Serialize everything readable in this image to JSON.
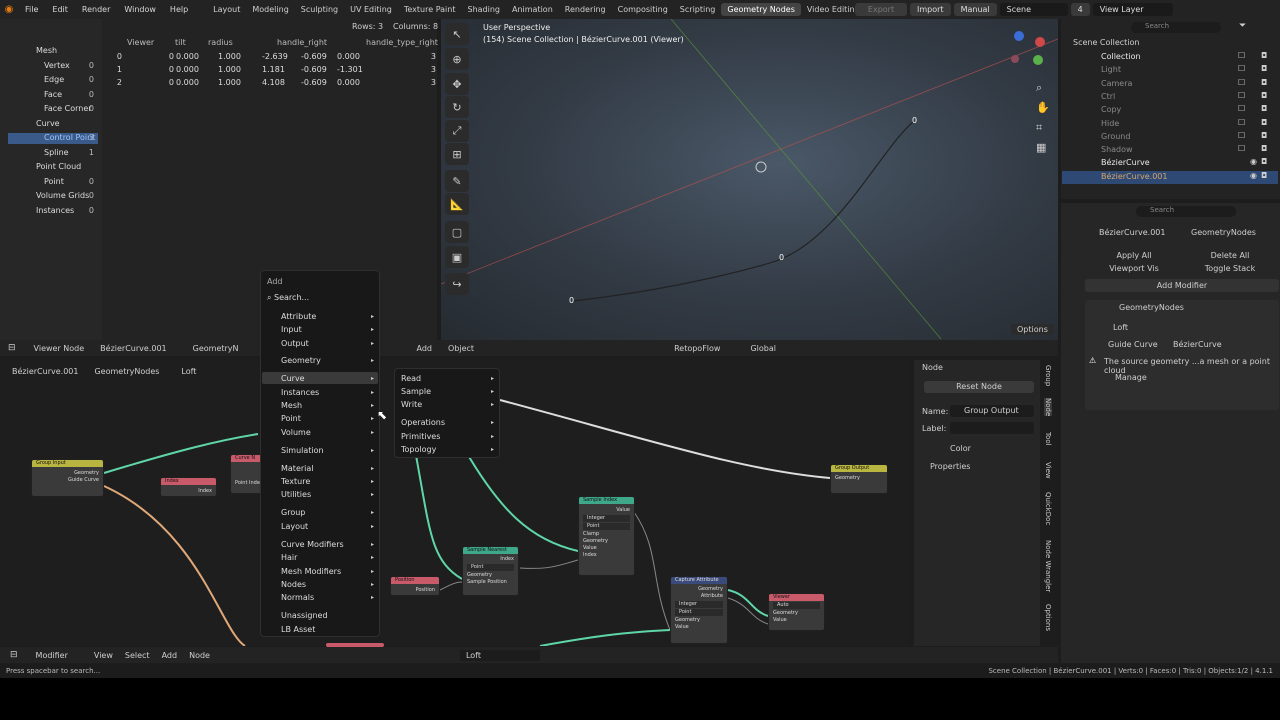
{
  "menubar": {
    "items": [
      "File",
      "Edit",
      "Render",
      "Window",
      "Help"
    ],
    "workspaces": [
      "Layout",
      "Modeling",
      "Sculpting",
      "UV Editing",
      "Texture Paint",
      "Shading",
      "Animation",
      "Rendering",
      "Compositing",
      "Scripting",
      "Geometry Nodes",
      "Video Editing"
    ],
    "export": "Export",
    "import": "Import",
    "manual": "Manual",
    "scene": "Scene",
    "scene_num": "4",
    "view_layer": "View Layer"
  },
  "spreadsheet": {
    "rows": "Rows: 3",
    "columns": "Columns: 8",
    "headers": [
      "Viewer",
      "tilt",
      "radius",
      "handle_right",
      "handle_type_right"
    ],
    "data": [
      [
        "0",
        "0",
        "0.000",
        "1.000",
        "-2.639",
        "-0.609",
        "0.000",
        "3"
      ],
      [
        "1",
        "0",
        "0.000",
        "1.000",
        "1.181",
        "-0.609",
        "-1.301",
        "3"
      ],
      [
        "2",
        "0",
        "0.000",
        "1.000",
        "4.108",
        "-0.609",
        "0.000",
        "3"
      ]
    ],
    "tree": [
      {
        "label": "Mesh",
        "count": ""
      },
      {
        "label": "Vertex",
        "count": "0"
      },
      {
        "label": "Edge",
        "count": "0"
      },
      {
        "label": "Face",
        "count": "0"
      },
      {
        "label": "Face Corner",
        "count": "0"
      },
      {
        "label": "Curve",
        "count": ""
      },
      {
        "label": "Control Point",
        "count": "3"
      },
      {
        "label": "Spline",
        "count": "1"
      },
      {
        "label": "Point Cloud",
        "count": ""
      },
      {
        "label": "Point",
        "count": "0"
      },
      {
        "label": "Volume Grids",
        "count": "0"
      },
      {
        "label": "Instances",
        "count": "0"
      }
    ]
  },
  "viewport": {
    "title": "User Perspective",
    "subtitle": "(154) Scene Collection | BézierCurve.001 (Viewer)",
    "pt_labels": [
      "0",
      "0",
      "0"
    ],
    "options": "Options"
  },
  "view_header": {
    "mode": "Viewer Node",
    "object": "BézierCurve.001",
    "geo": "GeometryN",
    "add": "Add",
    "object_menu": "Object",
    "retopo": "RetopoFlow",
    "global": "Global"
  },
  "node_header": {
    "crumb1": "BézierCurve.001",
    "crumb2": "GeometryNodes",
    "crumb3": "Loft"
  },
  "add_menu": {
    "title": "Add",
    "search": "Search...",
    "items": [
      "Attribute",
      "Input",
      "Output",
      "Geometry",
      "Curve",
      "Instances",
      "Mesh",
      "Point",
      "Volume",
      "Simulation",
      "Material",
      "Texture",
      "Utilities",
      "Group",
      "Layout",
      "Curve Modifiers",
      "Hair",
      "Mesh Modifiers",
      "Nodes",
      "Normals",
      "Unassigned",
      "LB Asset"
    ]
  },
  "sub_menu": {
    "items": [
      "Read",
      "Sample",
      "Write",
      "Operations",
      "Primitives",
      "Topology"
    ]
  },
  "nodes": {
    "group_input": {
      "title": "Group Input",
      "rows": [
        "Geometry",
        "Guide Curve"
      ]
    },
    "index": {
      "title": "Index",
      "rows": [
        "Index"
      ]
    },
    "curve_n": {
      "title": "Curve N",
      "rows": [
        "Point Index"
      ]
    },
    "group_output": {
      "title": "Group Output",
      "rows": [
        "Geometry"
      ]
    },
    "sample_index": {
      "title": "Sample Index",
      "rows": [
        "Value",
        "Integer",
        "Point",
        "Clamp",
        "Geometry",
        "Value",
        "Index"
      ]
    },
    "sample_nearest": {
      "title": "Sample Nearest",
      "rows": [
        "Index",
        "Point",
        "Geometry",
        "Sample Position"
      ]
    },
    "position": {
      "title": "Position",
      "rows": [
        "Position"
      ]
    },
    "capture": {
      "title": "Capture Attribute",
      "rows": [
        "Geometry",
        "Attribute",
        "Integer",
        "Point",
        "Geometry",
        "Value"
      ]
    },
    "viewer": {
      "title": "Viewer",
      "rows": [
        "Auto",
        "Geometry",
        "Value"
      ]
    }
  },
  "node_footer": {
    "items": [
      "Modifier",
      "View",
      "Select",
      "Add",
      "Node"
    ],
    "tree_name": "Loft"
  },
  "node_side": {
    "tab": "Node",
    "reset": "Reset Node",
    "name_label": "Name:",
    "name_val": "Group Output",
    "label_label": "Label:",
    "color": "Color",
    "properties": "Properties",
    "vtabs": [
      "Group",
      "Node",
      "Tool",
      "View",
      "QuickDoc",
      "Node Wrangler",
      "Options"
    ]
  },
  "outliner": {
    "search": "Search",
    "root": "Scene Collection",
    "items": [
      "Collection",
      "Light",
      "Camera",
      "Ctrl",
      "Copy",
      "Hide",
      "Ground",
      "Shadow",
      "BézierCurve",
      "BézierCurve.001"
    ]
  },
  "properties": {
    "search": "Search",
    "obj": "BézierCurve.001",
    "geo": "GeometryNodes",
    "apply": "Apply All",
    "delete": "Delete All",
    "viewport_vis": "Viewport Vis",
    "toggle": "Toggle Stack",
    "add_mod": "Add Modifier",
    "mod_name": "GeometryNodes",
    "tree": "Loft",
    "guide_label": "Guide Curve",
    "guide_val": "BézierCurve",
    "warning": "The source geometry ...a mesh or a point cloud",
    "manage": "Manage"
  },
  "status": {
    "left": "Press spacebar to search...",
    "right": "Scene Collection | BézierCurve.001 | Verts:0 | Faces:0 | Tris:0 | Objects:1/2 | 4.1.1"
  },
  "colors": {
    "accent": "#4772b3",
    "geo_socket": "#00d6a3",
    "selected": "#2e4a74"
  }
}
